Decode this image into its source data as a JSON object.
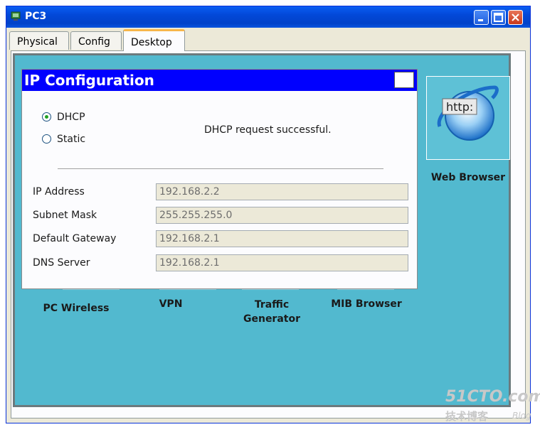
{
  "window": {
    "title": "PC3"
  },
  "tabs": [
    {
      "label": "Physical"
    },
    {
      "label": "Config"
    },
    {
      "label": "Desktop"
    }
  ],
  "desktop": {
    "web_browser": {
      "label": "Web Browser",
      "icon_text": "http:"
    },
    "apps": [
      {
        "label": "PC Wireless"
      },
      {
        "label": "VPN"
      },
      {
        "label": "Traffic Generator"
      },
      {
        "label": "MIB Browser"
      }
    ]
  },
  "ip_config": {
    "title": "IP Configuration",
    "close": "X",
    "mode_dhcp": "DHCP",
    "mode_static": "Static",
    "selected_mode": "DHCP",
    "status": "DHCP request successful.",
    "fields": [
      {
        "label": "IP Address",
        "value": "192.168.2.2"
      },
      {
        "label": "Subnet Mask",
        "value": "255.255.255.0"
      },
      {
        "label": "Default Gateway",
        "value": "192.168.2.1"
      },
      {
        "label": "DNS Server",
        "value": "192.168.2.1"
      }
    ]
  },
  "watermark": {
    "site": "51CTO.com",
    "subtitle": "技术博客",
    "blog": "Blog"
  }
}
